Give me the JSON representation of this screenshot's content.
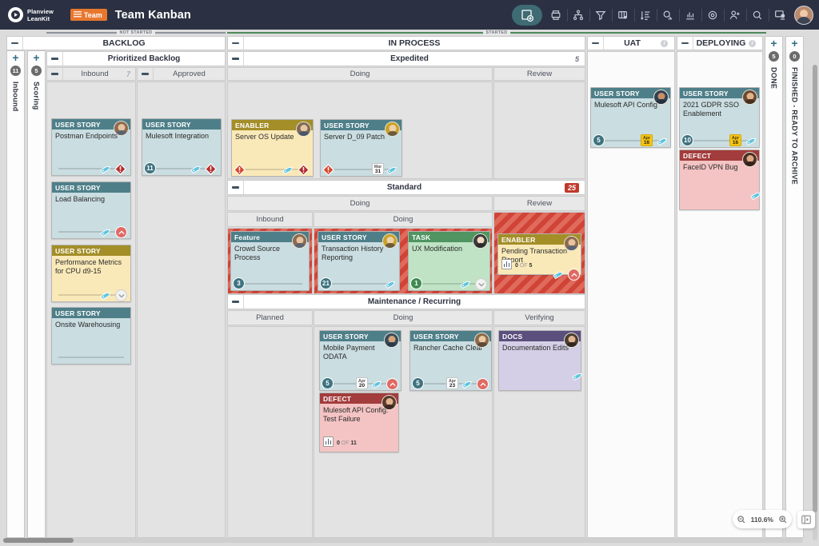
{
  "topbar": {
    "brand_line1": "Planview",
    "brand_line2": "LeanKit",
    "team_badge": "Team",
    "board_title": "Team Kanban",
    "tools": [
      {
        "name": "add-card-icon",
        "label": "Add Card"
      },
      {
        "name": "print-icon",
        "label": "Print"
      },
      {
        "name": "hierarchy-icon",
        "label": "Hierarchy"
      },
      {
        "name": "filter-icon",
        "label": "Filter"
      },
      {
        "name": "board-layout-icon",
        "label": "Board Layout"
      },
      {
        "name": "sort-icon",
        "label": "Sort"
      },
      {
        "name": "timer-icon",
        "label": "Timer"
      },
      {
        "name": "analytics-icon",
        "label": "Analytics"
      },
      {
        "name": "settings-icon",
        "label": "Settings"
      },
      {
        "name": "add-user-icon",
        "label": "Add User"
      },
      {
        "name": "search-icon",
        "label": "Search"
      },
      {
        "name": "notifications-icon",
        "label": "Notifications"
      }
    ]
  },
  "status_strips": [
    {
      "label": "NOT STARTED",
      "color": "#8f939c"
    },
    {
      "label": "STARTED",
      "color": "#4e8a5c"
    }
  ],
  "vlanes": [
    {
      "name": "inbound",
      "title": "Inbound",
      "count": "11",
      "plus": "+"
    },
    {
      "name": "scoring",
      "title": "Scoring",
      "count": "5",
      "plus": "+"
    },
    {
      "name": "done",
      "title": "DONE",
      "count": "5",
      "plus": "+"
    },
    {
      "name": "finished",
      "title": "FINISHED - READY TO ARCHIVE",
      "count": "0",
      "plus": "+"
    }
  ],
  "columns": {
    "backlog": {
      "title": "BACKLOG"
    },
    "in_process": {
      "title": "IN PROCESS"
    },
    "uat": {
      "title": "UAT",
      "info": "i"
    },
    "deploying": {
      "title": "DEPLOYING",
      "info": "i"
    }
  },
  "lanes": {
    "prioritized_backlog": {
      "title": "Prioritized Backlog"
    },
    "expedited": {
      "title": "Expedited",
      "wip": "5"
    },
    "standard": {
      "title": "Standard",
      "wip": "25"
    },
    "maintenance": {
      "title": "Maintenance / Recurring"
    }
  },
  "sublanes": {
    "inbound": {
      "title": "Inbound",
      "wip": "7"
    },
    "approved": {
      "title": "Approved"
    },
    "exp_doing": {
      "title": "Doing"
    },
    "exp_review": {
      "title": "Review"
    },
    "std_doing": {
      "title": "Doing"
    },
    "std_review": {
      "title": "Review"
    },
    "std_doing_inbound": {
      "title": "Inbound"
    },
    "std_doing_doing": {
      "title": "Doing"
    },
    "mnt_planned": {
      "title": "Planned"
    },
    "mnt_doing": {
      "title": "Doing"
    },
    "mnt_verifying": {
      "title": "Verifying"
    }
  },
  "cards": [
    {
      "id": "c1",
      "type": "USER STORY",
      "title": "Postman Endpoints",
      "type_color": "#4e7f89",
      "body_color": "#cadde1",
      "badges": [
        "tag",
        "alert-red"
      ]
    },
    {
      "id": "c2",
      "type": "USER STORY",
      "title": "Mulesoft Integration",
      "type_color": "#4e7f89",
      "body_color": "#cadde1",
      "size": "11",
      "size_color": "#3f7380",
      "badges": [
        "tag",
        "alert-red"
      ]
    },
    {
      "id": "c3",
      "type": "USER STORY",
      "title": "Load Balancing",
      "type_color": "#4e7f89",
      "body_color": "#cadde1",
      "badges": [
        "tag",
        "arrow-up"
      ]
    },
    {
      "id": "c4",
      "type": "USER STORY",
      "title": "Performance Metrics for CPU d9-15",
      "type_color": "#a38e28",
      "body_color": "#fae9b8",
      "badges": [
        "tag",
        "arrow-down"
      ]
    },
    {
      "id": "c5",
      "type": "USER STORY",
      "title": "Onsite Warehousing",
      "type_color": "#4e7f89",
      "body_color": "#cadde1",
      "badges": []
    },
    {
      "id": "c6",
      "type": "ENABLER",
      "title": "Server OS Update",
      "type_color": "#a38e28",
      "body_color": "#fae9b8",
      "badges": [
        "alert-orange",
        "tag",
        "alert-red"
      ]
    },
    {
      "id": "c7",
      "type": "USER STORY",
      "title": "Server D_09 Patch",
      "type_color": "#4e7f89",
      "body_color": "#cadde1",
      "badges": [
        "alert-orange",
        "date",
        "tag"
      ],
      "date_month": "Mar",
      "date_day": "31",
      "date_style": "white"
    },
    {
      "id": "c8",
      "type": "Feature",
      "title": "Crowd Source Process",
      "type_color": "#4e7f89",
      "body_color": "#cadde1",
      "size": "3",
      "size_color": "#3f7380",
      "badges": []
    },
    {
      "id": "c9",
      "type": "USER STORY",
      "title": "Transaction History Reporting",
      "type_color": "#4e7f89",
      "body_color": "#cadde1",
      "size": "21",
      "size_color": "#3f7380",
      "badges": [
        "tag"
      ]
    },
    {
      "id": "c10",
      "type": "TASK",
      "title": "UX Modification",
      "type_color": "#4f9461",
      "body_color": "#bfe3c4",
      "size": "1",
      "size_color": "#3f8a52",
      "badges": [
        "tag",
        "arrow-down"
      ]
    },
    {
      "id": "c11",
      "type": "ENABLER",
      "title": "Pending Transaction Report",
      "type_color": "#a38e28",
      "body_color": "#fae9b8",
      "progress_done": "0",
      "progress_of": "OF",
      "progress_total": "5",
      "badges": [
        "tag",
        "arrow-up"
      ]
    },
    {
      "id": "c12",
      "type": "USER STORY",
      "title": "Mobile Payment ODATA",
      "type_color": "#4e7f89",
      "body_color": "#cadde1",
      "size": "5",
      "size_color": "#3f7380",
      "badges": [
        "date",
        "tag",
        "arrow-up"
      ],
      "date_month": "Apr",
      "date_day": "20",
      "date_style": "white"
    },
    {
      "id": "c13",
      "type": "DEFECT",
      "title": "Mulesoft API Config: Test Failure",
      "type_color": "#a33c3c",
      "body_color": "#f4c3c3",
      "progress_done": "0",
      "progress_of": "OF",
      "progress_total": "11",
      "badges": []
    },
    {
      "id": "c14",
      "type": "USER STORY",
      "title": "Rancher Cache Clear",
      "type_color": "#4e7f89",
      "body_color": "#cadde1",
      "size": "5",
      "size_color": "#3f7380",
      "badges": [
        "date",
        "tag",
        "arrow-up"
      ],
      "date_month": "Apr",
      "date_day": "23",
      "date_style": "white"
    },
    {
      "id": "c15",
      "type": "DOCS",
      "title": "Documentation Edits",
      "type_color": "#5b4f7d",
      "body_color": "#d4cfe6",
      "badges": [
        "tag"
      ]
    },
    {
      "id": "c16",
      "type": "USER STORY",
      "title": "Mulesoft API Config",
      "type_color": "#4e7f89",
      "body_color": "#cadde1",
      "size": "5",
      "size_color": "#3f7380",
      "badges": [
        "date",
        "tag"
      ],
      "date_month": "Apr",
      "date_day": "16",
      "date_style": "yellow"
    },
    {
      "id": "c17",
      "type": "USER STORY",
      "title": "2021 GDPR SSO Enablement",
      "type_color": "#4e7f89",
      "body_color": "#cadde1",
      "size": "10",
      "size_color": "#3f7380",
      "badges": [
        "date",
        "tag"
      ],
      "date_month": "Apr",
      "date_day": "16",
      "date_style": "yellow"
    },
    {
      "id": "c18",
      "type": "DEFECT",
      "title": "FaceID VPN Bug",
      "type_color": "#a33c3c",
      "body_color": "#f4c3c3",
      "badges": [
        "tag"
      ]
    }
  ],
  "zoom": {
    "value": "110.6%",
    "zoom_out": "zoom-out",
    "zoom_in": "zoom-in"
  },
  "colors": {
    "accent": "#e8772e",
    "topbar": "#2b3142",
    "wip_over": "#c0392b",
    "started": "#4e8a5c",
    "not_started": "#8f939c"
  }
}
